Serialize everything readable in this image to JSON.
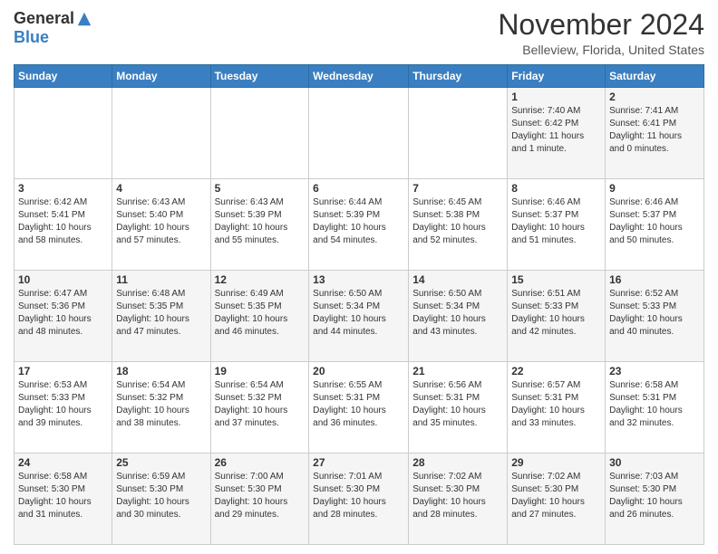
{
  "header": {
    "logo_general": "General",
    "logo_blue": "Blue",
    "month": "November 2024",
    "location": "Belleview, Florida, United States"
  },
  "weekdays": [
    "Sunday",
    "Monday",
    "Tuesday",
    "Wednesday",
    "Thursday",
    "Friday",
    "Saturday"
  ],
  "weeks": [
    [
      {
        "day": "",
        "info": ""
      },
      {
        "day": "",
        "info": ""
      },
      {
        "day": "",
        "info": ""
      },
      {
        "day": "",
        "info": ""
      },
      {
        "day": "",
        "info": ""
      },
      {
        "day": "1",
        "info": "Sunrise: 7:40 AM\nSunset: 6:42 PM\nDaylight: 11 hours\nand 1 minute."
      },
      {
        "day": "2",
        "info": "Sunrise: 7:41 AM\nSunset: 6:41 PM\nDaylight: 11 hours\nand 0 minutes."
      }
    ],
    [
      {
        "day": "3",
        "info": "Sunrise: 6:42 AM\nSunset: 5:41 PM\nDaylight: 10 hours\nand 58 minutes."
      },
      {
        "day": "4",
        "info": "Sunrise: 6:43 AM\nSunset: 5:40 PM\nDaylight: 10 hours\nand 57 minutes."
      },
      {
        "day": "5",
        "info": "Sunrise: 6:43 AM\nSunset: 5:39 PM\nDaylight: 10 hours\nand 55 minutes."
      },
      {
        "day": "6",
        "info": "Sunrise: 6:44 AM\nSunset: 5:39 PM\nDaylight: 10 hours\nand 54 minutes."
      },
      {
        "day": "7",
        "info": "Sunrise: 6:45 AM\nSunset: 5:38 PM\nDaylight: 10 hours\nand 52 minutes."
      },
      {
        "day": "8",
        "info": "Sunrise: 6:46 AM\nSunset: 5:37 PM\nDaylight: 10 hours\nand 51 minutes."
      },
      {
        "day": "9",
        "info": "Sunrise: 6:46 AM\nSunset: 5:37 PM\nDaylight: 10 hours\nand 50 minutes."
      }
    ],
    [
      {
        "day": "10",
        "info": "Sunrise: 6:47 AM\nSunset: 5:36 PM\nDaylight: 10 hours\nand 48 minutes."
      },
      {
        "day": "11",
        "info": "Sunrise: 6:48 AM\nSunset: 5:35 PM\nDaylight: 10 hours\nand 47 minutes."
      },
      {
        "day": "12",
        "info": "Sunrise: 6:49 AM\nSunset: 5:35 PM\nDaylight: 10 hours\nand 46 minutes."
      },
      {
        "day": "13",
        "info": "Sunrise: 6:50 AM\nSunset: 5:34 PM\nDaylight: 10 hours\nand 44 minutes."
      },
      {
        "day": "14",
        "info": "Sunrise: 6:50 AM\nSunset: 5:34 PM\nDaylight: 10 hours\nand 43 minutes."
      },
      {
        "day": "15",
        "info": "Sunrise: 6:51 AM\nSunset: 5:33 PM\nDaylight: 10 hours\nand 42 minutes."
      },
      {
        "day": "16",
        "info": "Sunrise: 6:52 AM\nSunset: 5:33 PM\nDaylight: 10 hours\nand 40 minutes."
      }
    ],
    [
      {
        "day": "17",
        "info": "Sunrise: 6:53 AM\nSunset: 5:33 PM\nDaylight: 10 hours\nand 39 minutes."
      },
      {
        "day": "18",
        "info": "Sunrise: 6:54 AM\nSunset: 5:32 PM\nDaylight: 10 hours\nand 38 minutes."
      },
      {
        "day": "19",
        "info": "Sunrise: 6:54 AM\nSunset: 5:32 PM\nDaylight: 10 hours\nand 37 minutes."
      },
      {
        "day": "20",
        "info": "Sunrise: 6:55 AM\nSunset: 5:31 PM\nDaylight: 10 hours\nand 36 minutes."
      },
      {
        "day": "21",
        "info": "Sunrise: 6:56 AM\nSunset: 5:31 PM\nDaylight: 10 hours\nand 35 minutes."
      },
      {
        "day": "22",
        "info": "Sunrise: 6:57 AM\nSunset: 5:31 PM\nDaylight: 10 hours\nand 33 minutes."
      },
      {
        "day": "23",
        "info": "Sunrise: 6:58 AM\nSunset: 5:31 PM\nDaylight: 10 hours\nand 32 minutes."
      }
    ],
    [
      {
        "day": "24",
        "info": "Sunrise: 6:58 AM\nSunset: 5:30 PM\nDaylight: 10 hours\nand 31 minutes."
      },
      {
        "day": "25",
        "info": "Sunrise: 6:59 AM\nSunset: 5:30 PM\nDaylight: 10 hours\nand 30 minutes."
      },
      {
        "day": "26",
        "info": "Sunrise: 7:00 AM\nSunset: 5:30 PM\nDaylight: 10 hours\nand 29 minutes."
      },
      {
        "day": "27",
        "info": "Sunrise: 7:01 AM\nSunset: 5:30 PM\nDaylight: 10 hours\nand 28 minutes."
      },
      {
        "day": "28",
        "info": "Sunrise: 7:02 AM\nSunset: 5:30 PM\nDaylight: 10 hours\nand 28 minutes."
      },
      {
        "day": "29",
        "info": "Sunrise: 7:02 AM\nSunset: 5:30 PM\nDaylight: 10 hours\nand 27 minutes."
      },
      {
        "day": "30",
        "info": "Sunrise: 7:03 AM\nSunset: 5:30 PM\nDaylight: 10 hours\nand 26 minutes."
      }
    ]
  ]
}
